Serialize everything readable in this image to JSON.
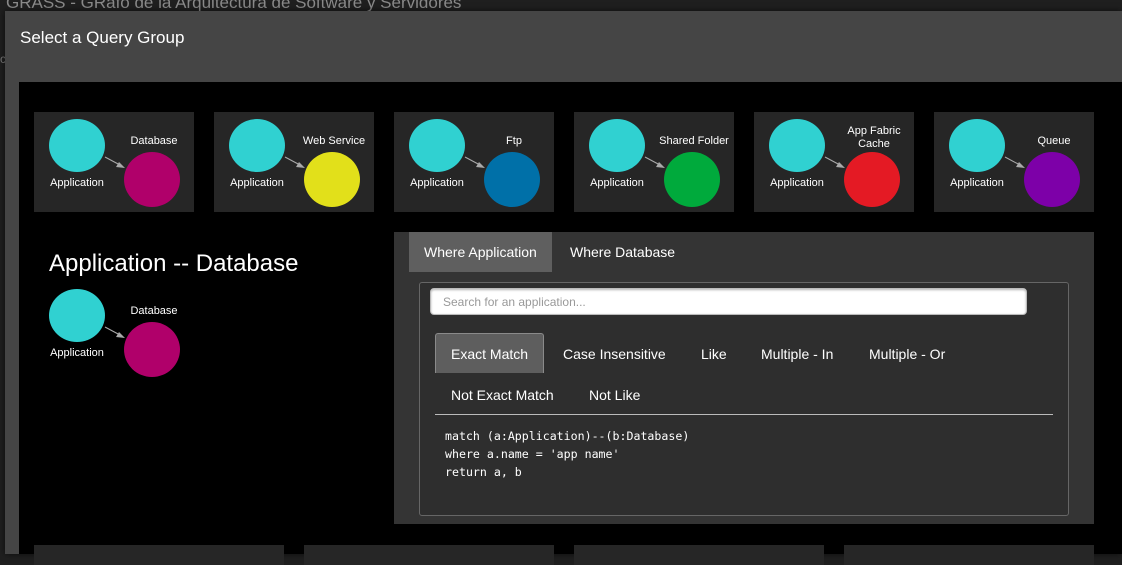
{
  "background": {
    "app_title": "GRASS - GRafo de la Arquitectura de Software y Servidores",
    "stub": "c"
  },
  "modal": {
    "title": "Select a Query Group"
  },
  "groups": [
    {
      "source": "Application",
      "target": "Database",
      "target_color": "#b0006a"
    },
    {
      "source": "Application",
      "target": "Web Service",
      "target_color": "#e2e01a"
    },
    {
      "source": "Application",
      "target": "Ftp",
      "target_color": "#0070a8"
    },
    {
      "source": "Application",
      "target": "Shared Folder",
      "target_color": "#00aa3c"
    },
    {
      "source": "Application",
      "target": "App Fabric Cache",
      "target_color": "#e41a24"
    },
    {
      "source": "Application",
      "target": "Queue",
      "target_color": "#7d00a8"
    }
  ],
  "colors": {
    "source_node": "#30d1d1"
  },
  "detail": {
    "title": "Application -- Database",
    "source": "Application",
    "target": "Database",
    "target_color": "#b0006a"
  },
  "panel": {
    "tabs": [
      "Where Application",
      "Where Database"
    ],
    "active_tab": "Where Application",
    "search_placeholder": "Search for an application...",
    "query_tabs": [
      "Exact Match",
      "Case Insensitive",
      "Like",
      "Multiple - In",
      "Multiple - Or",
      "Not Exact Match",
      "Not Like"
    ],
    "active_query_tab": "Exact Match",
    "code": "match (a:Application)--(b:Database)\nwhere a.name = 'app name'\nreturn a, b"
  }
}
